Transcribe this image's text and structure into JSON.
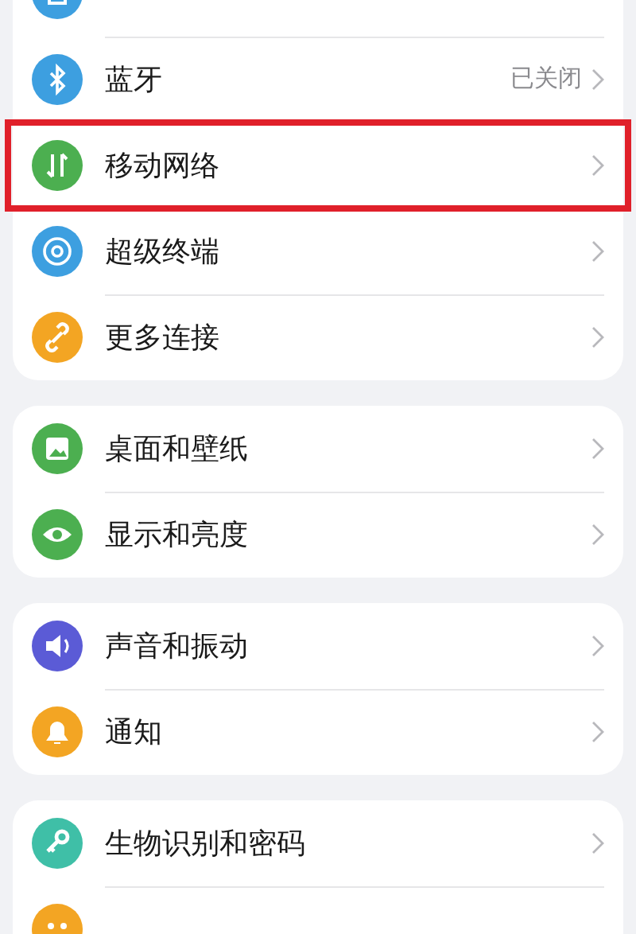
{
  "groups": [
    {
      "items": [
        {
          "color": "#3d9fe0",
          "highlighted": false
        },
        {
          "label": "蓝牙",
          "value": "已关闭",
          "color": "#3d9fe0",
          "highlighted": false
        },
        {
          "label": "移动网络",
          "color": "#4caf50",
          "highlighted": true
        },
        {
          "label": "超级终端",
          "color": "#3d9fe0",
          "highlighted": false
        },
        {
          "label": "更多连接",
          "color": "#f3a523",
          "highlighted": false
        }
      ]
    },
    {
      "items": [
        {
          "label": "桌面和壁纸",
          "color": "#4caf50",
          "highlighted": false
        },
        {
          "label": "显示和亮度",
          "color": "#4caf50",
          "highlighted": false
        }
      ]
    },
    {
      "items": [
        {
          "label": "声音和振动",
          "color": "#5b5bd6",
          "highlighted": false
        },
        {
          "label": "通知",
          "color": "#f3a523",
          "highlighted": false
        }
      ]
    },
    {
      "items": [
        {
          "label": "生物识别和密码",
          "color": "#3fbfa7",
          "highlighted": false
        },
        {
          "color": "#f3a523",
          "highlighted": false
        }
      ]
    }
  ]
}
